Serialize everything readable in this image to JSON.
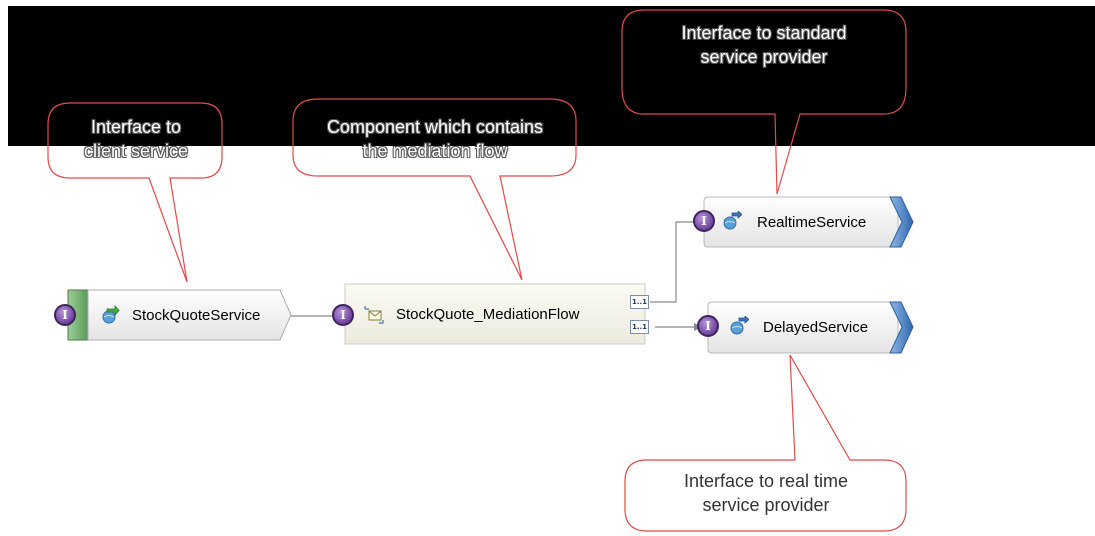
{
  "callouts": {
    "client": {
      "lines": [
        "Interface to",
        "client service"
      ]
    },
    "component": {
      "lines": [
        "Component which contains",
        "the mediation flow"
      ]
    },
    "standard": {
      "lines": [
        "Interface to standard",
        "service provider"
      ]
    },
    "realtime": {
      "lines": [
        "Interface to real time",
        "service provider"
      ]
    }
  },
  "nodes": {
    "export": {
      "label": "StockQuoteService",
      "icon": "web-service-export-icon"
    },
    "mediation": {
      "label": "StockQuote_MediationFlow",
      "icon": "mediation-flow-icon"
    },
    "realtime": {
      "label": "RealtimeService",
      "icon": "web-service-import-icon"
    },
    "delayed": {
      "label": "DelayedService",
      "icon": "web-service-import-icon"
    }
  },
  "badges": {
    "interface_letter": "I",
    "multiplicity_top": "1..1",
    "multiplicity_bottom": "1..1"
  },
  "colors": {
    "callout_border": "#e04b4b",
    "interface_badge": "#7a4fa6",
    "export_bar": "#6aa86a",
    "import_arrow": "#3f76b8",
    "connector": "#888888"
  }
}
